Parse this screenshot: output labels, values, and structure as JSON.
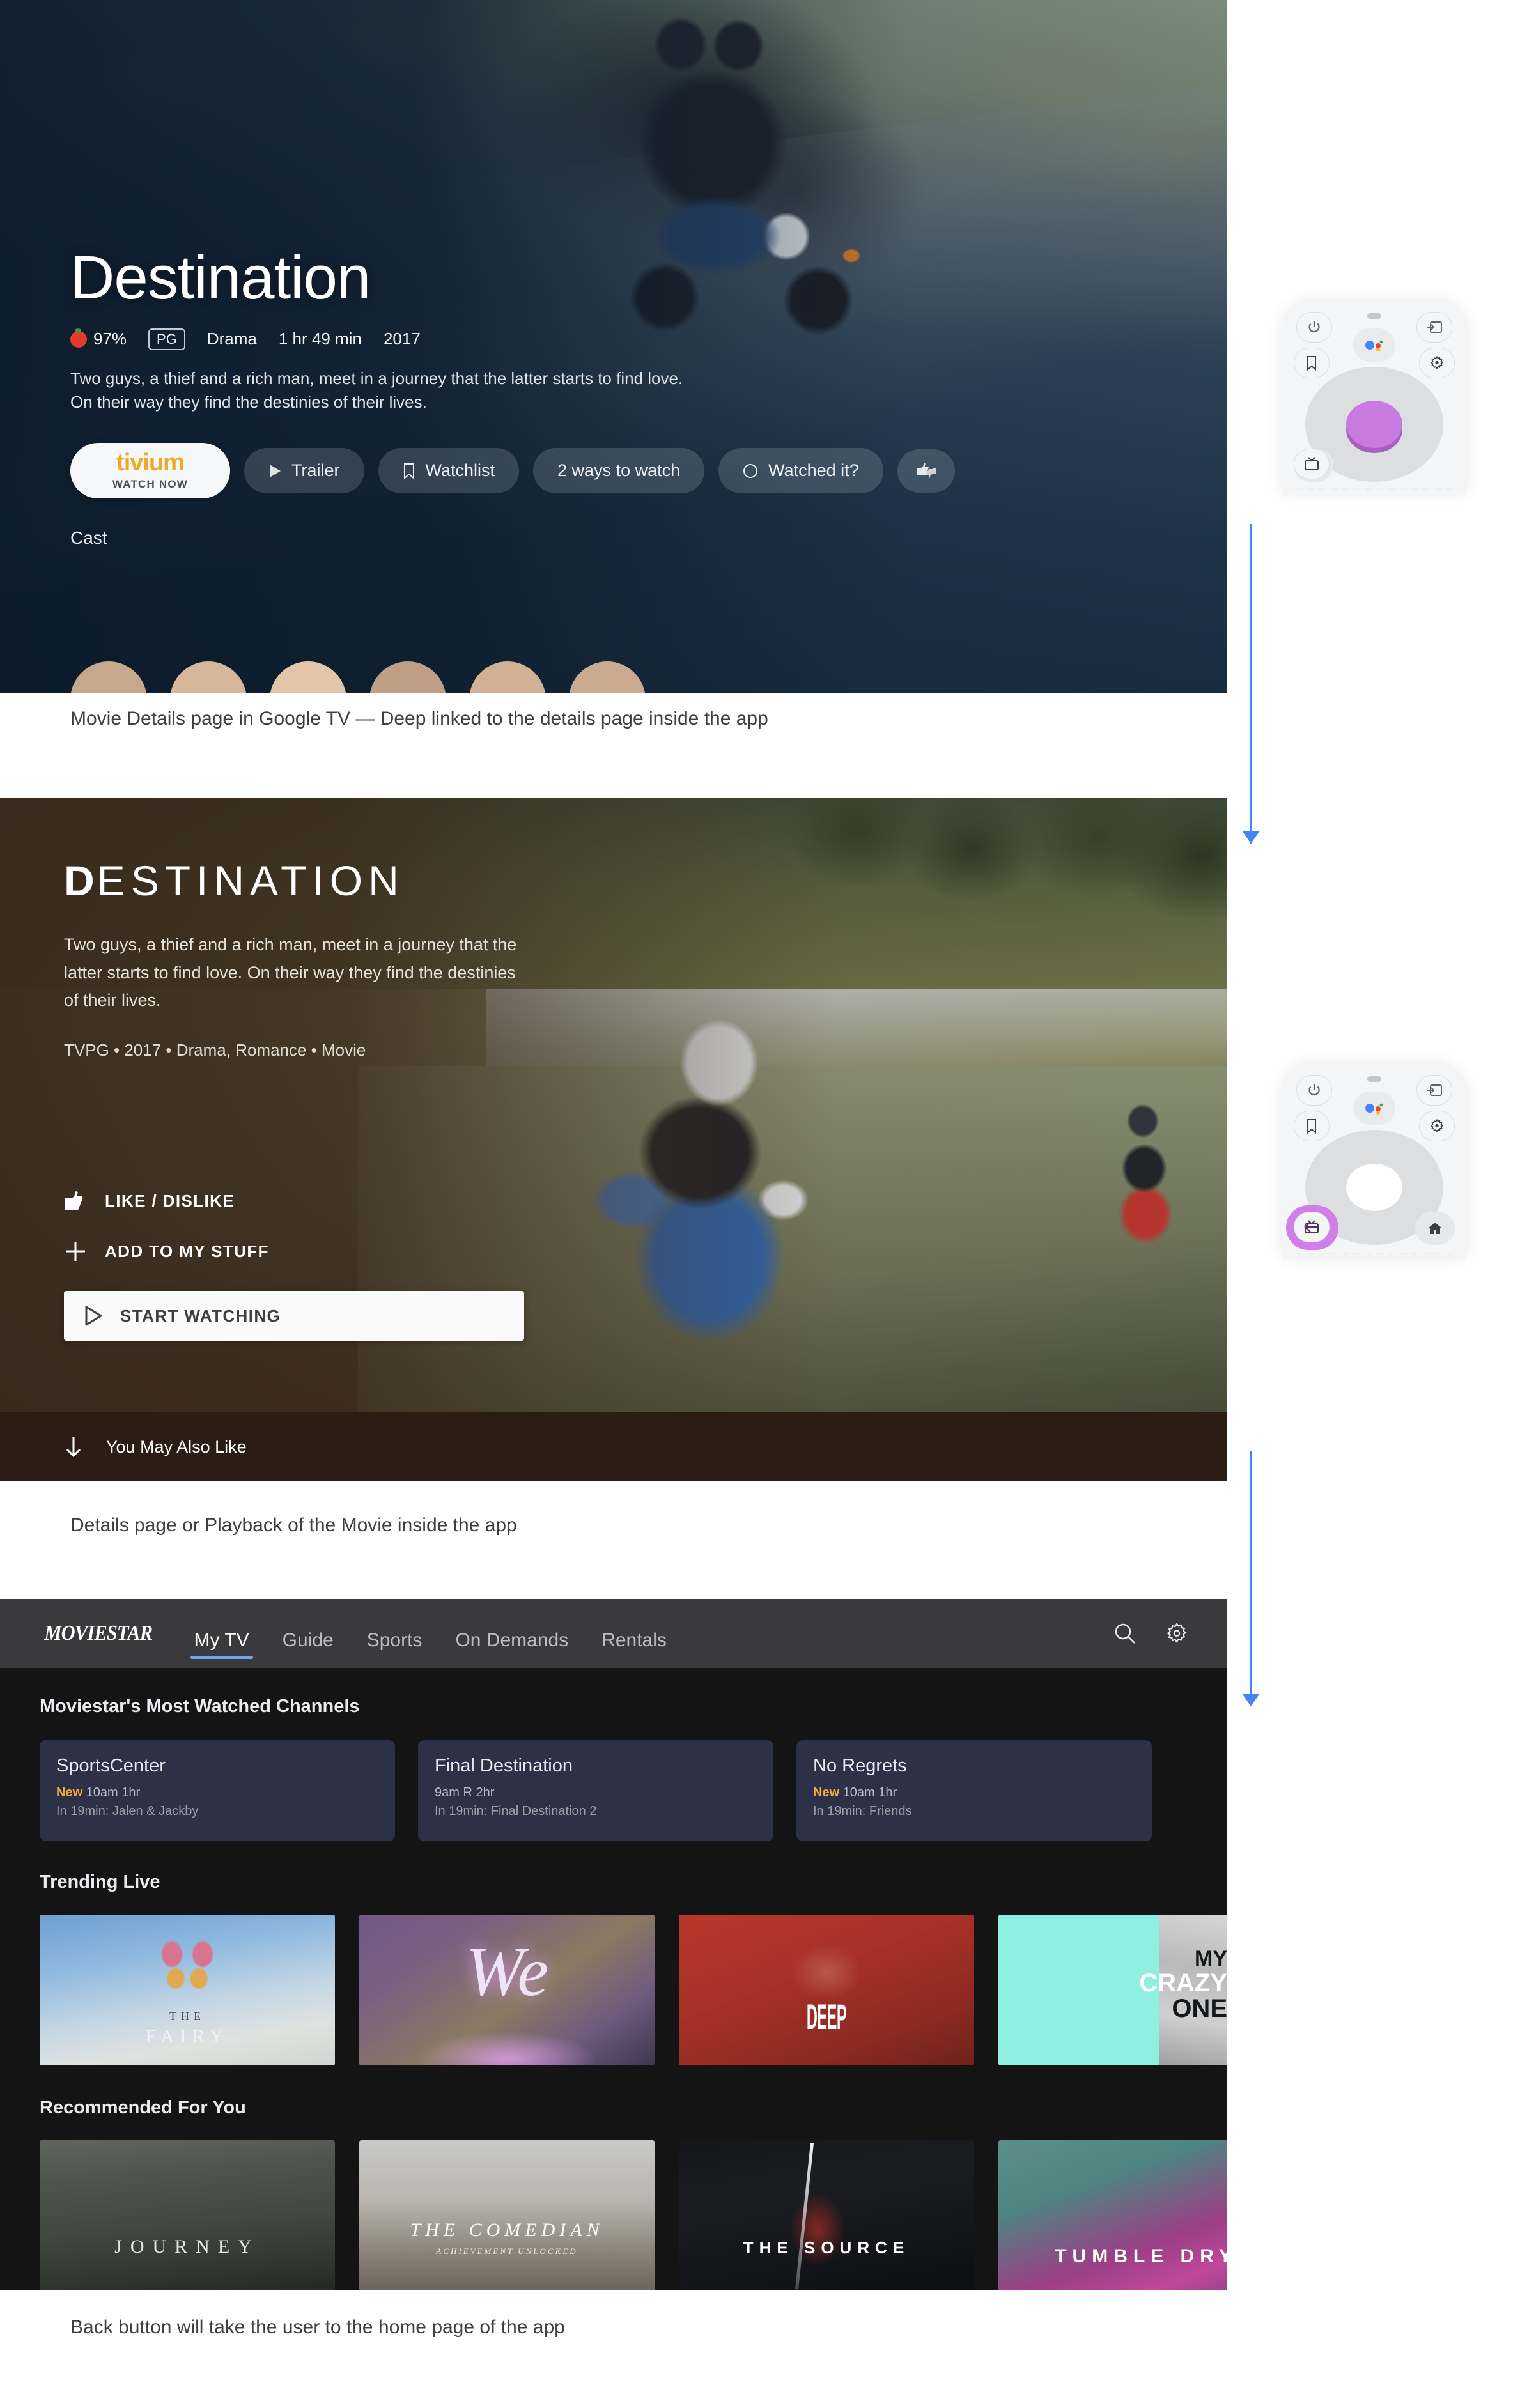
{
  "panel1": {
    "title": "Destination",
    "rating_percent": "97%",
    "content_rating": "PG",
    "genre": "Drama",
    "runtime": "1 hr 49 min",
    "year": "2017",
    "description": "Two guys, a thief and a rich man, meet in a journey that the latter starts to find love. On their way they find the destinies of their lives.",
    "provider_name": "tivium",
    "provider_sub": "WATCH NOW",
    "trailer_label": "Trailer",
    "watchlist_label": "Watchlist",
    "ways_to_watch_label": "2 ways to watch",
    "watched_it_label": "Watched it?",
    "cast_label": "Cast",
    "caption": "Movie Details page in Google TV — Deep linked to the details page inside the app"
  },
  "panel2": {
    "title_cap": "D",
    "title_rest": "ESTINATION",
    "description": "Two guys, a thief and a rich man, meet in a journey that the latter starts to find love. On their way they find the destinies of their lives.",
    "meta": "TVPG • 2017 • Drama, Romance • Movie",
    "like_dislike_label": "LIKE / DISLIKE",
    "add_label": "ADD TO MY STUFF",
    "start_watching_label": "START WATCHING",
    "you_may_also_like_label": "You May Also Like",
    "caption": "Details page or Playback of the Movie inside the app"
  },
  "panel3": {
    "brand": "MOVIESTAR",
    "tabs": [
      {
        "label": "My TV",
        "active": true
      },
      {
        "label": "Guide",
        "active": false
      },
      {
        "label": "Sports",
        "active": false
      },
      {
        "label": "On Demands",
        "active": false
      },
      {
        "label": "Rentals",
        "active": false
      }
    ],
    "search_icon": "search-icon",
    "settings_icon": "gear-icon",
    "section_channels_title": "Moviestar's Most Watched Channels",
    "channels": [
      {
        "name": "SportsCenter",
        "new": "New",
        "time": "10am 1hr",
        "next": "In 19min: Jalen & Jackby"
      },
      {
        "name": "Final Destination",
        "new": "",
        "time": "9am R 2hr",
        "next": "In 19min: Final Destination 2"
      },
      {
        "name": "No Regrets",
        "new": "New",
        "time": "10am 1hr",
        "next": "In 19min: Friends"
      }
    ],
    "section_trending_title": "Trending Live",
    "trending": [
      {
        "line1": "THE",
        "line2": "FAIRY"
      },
      {
        "line1": "We",
        "line2": ""
      },
      {
        "line1": "DEEP",
        "line2": ""
      },
      {
        "line1": "MY",
        "line2": "CRAZY",
        "line3": "ONE"
      }
    ],
    "section_recommended_title": "Recommended For You",
    "recommended": [
      {
        "title": "JOURNEY",
        "sub": ""
      },
      {
        "title": "THE COMEDIAN",
        "sub": "ACHIEVEMENT UNLOCKED"
      },
      {
        "title": "THE SOURCE",
        "sub": ""
      },
      {
        "title": "TUMBLE DRY",
        "sub": ""
      }
    ],
    "caption": "Back button will take the user to the home page of the app"
  },
  "remotes": {
    "power_icon": "power-icon",
    "input_icon": "input-source-icon",
    "bookmark_icon": "bookmark-icon",
    "assistant_icon": "google-assistant-icon",
    "settings_icon": "gear-icon",
    "back_icon": "back-arrow-icon",
    "home_icon": "home-icon",
    "live_tv_icon": "live-tv-icon",
    "highlight_color": "#c97ae0",
    "arrow_color": "#4285f4"
  }
}
